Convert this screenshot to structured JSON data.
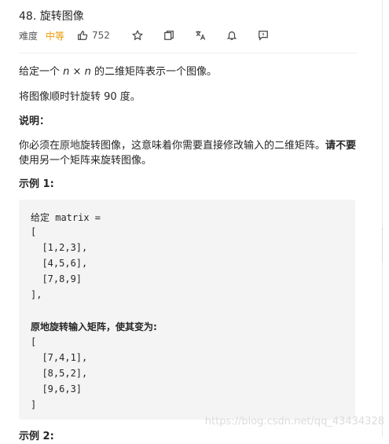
{
  "problem": {
    "title": "48. 旋转图像",
    "difficulty_label": "难度",
    "difficulty": "中等",
    "likes": "752"
  },
  "toolbar_icons": [
    "thumbs-up-icon",
    "star-icon",
    "share-icon",
    "translate-icon",
    "bell-icon",
    "feedback-icon"
  ],
  "description": {
    "p1_prefix": "给定一个 ",
    "p1_n1": "n",
    "p1_times": " × ",
    "p1_n2": "n",
    "p1_suffix": " 的二维矩阵表示一个图像。",
    "p2": "将图像顺时针旋转 90 度。",
    "note_heading": "说明：",
    "p3_a": "你必须在",
    "p3_inplace": "原地",
    "p3_b": "旋转图像，这意味着你需要直接修改输入的二维矩阵。",
    "p3_bold": "请不要",
    "p3_c": "使用另一个矩阵来旋转图像。",
    "example1_heading": "示例 1:",
    "example2_heading": "示例 2:"
  },
  "code_lines": [
    "给定 matrix =",
    "[",
    "  [1,2,3],",
    "  [4,5,6],",
    "  [7,8,9]",
    "],",
    "原地旋转输入矩阵，使其变为:",
    "[",
    "  [7,4,1],",
    "  [8,5,2],",
    "  [9,6,3]",
    "]"
  ],
  "watermark": "https://blog.csdn.net/qq_43434328",
  "colors": {
    "difficulty": "#ef9a00",
    "code_bg": "#f4f4f4",
    "text": "#262626"
  }
}
